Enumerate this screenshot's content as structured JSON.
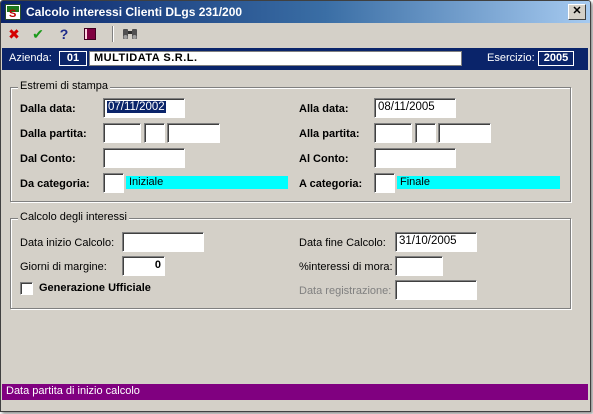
{
  "window": {
    "title": "Calcolo interessi Clienti DLgs 231/200",
    "close_glyph": "✕"
  },
  "toolbar": {
    "buttons": [
      {
        "name": "cancel",
        "icon": "red-x-icon",
        "glyph": "✖",
        "color": "#d40000"
      },
      {
        "name": "confirm",
        "icon": "green-check-icon",
        "glyph": "✔",
        "color": "#1a9a1a"
      },
      {
        "name": "help",
        "icon": "question-mark-icon",
        "glyph": "?",
        "color": "#1c2a8a"
      },
      {
        "name": "book",
        "icon": "book-icon",
        "glyph": "📕",
        "color": "#800040"
      },
      {
        "name": "search",
        "icon": "binoculars-icon",
        "glyph": "⚲",
        "color": "#404040"
      }
    ]
  },
  "azienda": {
    "label": "Azienda:",
    "code": "01",
    "name": "MULTIDATA S.R.L.",
    "esercizio_label": "Esercizio:",
    "esercizio": "2005"
  },
  "estremi": {
    "title": "Estremi di stampa",
    "dalla_data_label": "Dalla data:",
    "dalla_data": "07/11/2002",
    "alla_data_label": "Alla data:",
    "alla_data": "08/11/2005",
    "dalla_partita_label": "Dalla partita:",
    "dalla_partita": [
      "",
      "",
      ""
    ],
    "alla_partita_label": "Alla partita:",
    "alla_partita": [
      "",
      "",
      ""
    ],
    "dal_conto_label": "Dal Conto:",
    "dal_conto": "",
    "al_conto_label": "Al Conto:",
    "al_conto": "",
    "da_categoria_label": "Da categoria:",
    "da_categoria_code": "",
    "da_categoria_desc": "Iniziale",
    "a_categoria_label": "A categoria:",
    "a_categoria_code": "",
    "a_categoria_desc": "Finale"
  },
  "calcolo": {
    "title": "Calcolo degli interessi",
    "data_inizio_label": "Data inizio Calcolo:",
    "data_inizio": "",
    "data_fine_label": "Data fine Calcolo:",
    "data_fine": "31/10/2005",
    "giorni_margine_label": "Giorni di margine:",
    "giorni_margine": "0",
    "interessi_mora_label": "%interessi di  mora:",
    "interessi_mora": "",
    "generazione_label": "Generazione Ufficiale",
    "generazione_checked": false,
    "data_registrazione_label": "Data registrazione:",
    "data_registrazione": ""
  },
  "status": {
    "text": "Data partita di inizio calcolo"
  },
  "colors": {
    "title_bar": "#0a246a",
    "azienda_bar": "#0a246a",
    "status_bar": "#800080",
    "category_highlight": "#00ffff",
    "window_bg": "#d4d0c8"
  }
}
